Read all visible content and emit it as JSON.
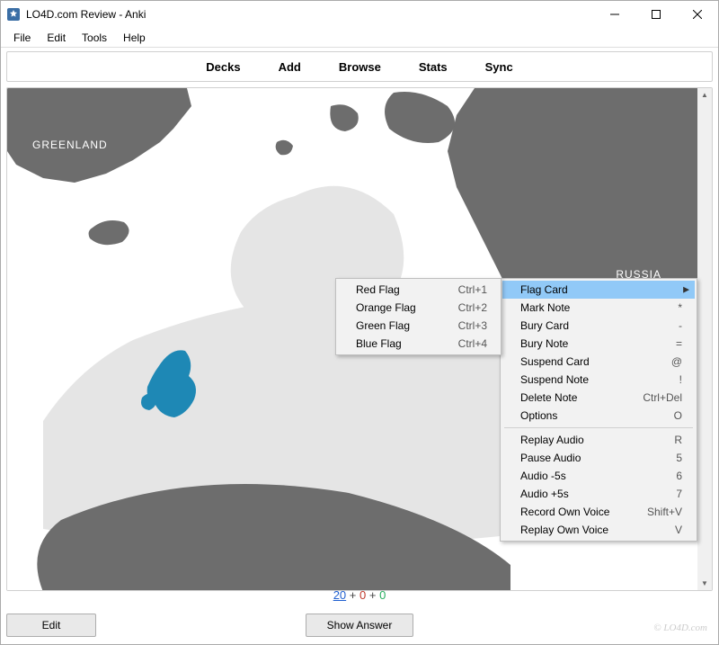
{
  "window": {
    "title": "LO4D.com Review - Anki"
  },
  "menubar": [
    "File",
    "Edit",
    "Tools",
    "Help"
  ],
  "toolbar": [
    "Decks",
    "Add",
    "Browse",
    "Stats",
    "Sync"
  ],
  "map_labels": {
    "greenland": "GREENLAND",
    "russia": "RUSSIA"
  },
  "stats": {
    "new": "20",
    "plus1": "+",
    "learn": "0",
    "plus2": "+",
    "review": "0"
  },
  "footer": {
    "edit": "Edit",
    "show_answer": "Show Answer"
  },
  "context_menu": {
    "items": [
      {
        "label": "Flag Card",
        "shortcut": "",
        "highlight": true,
        "submenu": true
      },
      {
        "label": "Mark Note",
        "shortcut": "*"
      },
      {
        "label": "Bury Card",
        "shortcut": "-"
      },
      {
        "label": "Bury Note",
        "shortcut": "="
      },
      {
        "label": "Suspend Card",
        "shortcut": "@"
      },
      {
        "label": "Suspend Note",
        "shortcut": "!"
      },
      {
        "label": "Delete Note",
        "shortcut": "Ctrl+Del"
      },
      {
        "label": "Options",
        "shortcut": "O"
      },
      {
        "sep": true
      },
      {
        "label": "Replay Audio",
        "shortcut": "R"
      },
      {
        "label": "Pause Audio",
        "shortcut": "5"
      },
      {
        "label": "Audio -5s",
        "shortcut": "6"
      },
      {
        "label": "Audio +5s",
        "shortcut": "7"
      },
      {
        "label": "Record Own Voice",
        "shortcut": "Shift+V"
      },
      {
        "label": "Replay Own Voice",
        "shortcut": "V"
      }
    ]
  },
  "submenu": {
    "items": [
      {
        "label": "Red Flag",
        "shortcut": "Ctrl+1"
      },
      {
        "label": "Orange Flag",
        "shortcut": "Ctrl+2"
      },
      {
        "label": "Green Flag",
        "shortcut": "Ctrl+3"
      },
      {
        "label": "Blue Flag",
        "shortcut": "Ctrl+4"
      }
    ]
  },
  "watermark": "© LO4D.com"
}
